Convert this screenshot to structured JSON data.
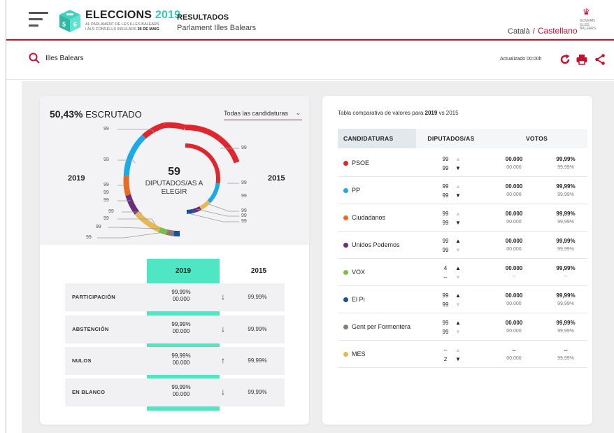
{
  "header": {
    "logo_title": "ELECCIONS",
    "logo_year": "2019",
    "logo_sub1": "AL PARLAMENT DE LES ILLES BALEARS",
    "logo_sub2": "I ALS CONSELLS INSULARS",
    "logo_date": "26 DE MAIG",
    "page_title": "RESULTADOS",
    "page_subtitle": "Parlament Illes Balears",
    "lang_ca": "Català",
    "lang_sep": "/",
    "lang_es": "Castellano",
    "govern_text": [
      "GOVERN",
      "ILLES",
      "BALEARS"
    ]
  },
  "search": {
    "value": "Illes Balears",
    "updated": "Actualizado 00:00h"
  },
  "colors": {
    "accent": "#c8102e",
    "teal": "#4ee6c3",
    "PSOE": "#e0262d",
    "PP": "#1ca9e6",
    "Ciudadanos": "#eb6a22",
    "Unidos Podemos": "#6a2e7c",
    "VOX": "#7ac143",
    "El Pi": "#1a4f9c",
    "Gent per Formentera": "#8c7b75",
    "MES": "#e6b855"
  },
  "summary": {
    "percent": "50,43%",
    "label": "ESCRUTADO",
    "filter": "Todas las candidaturas",
    "year_left": "2019",
    "year_right": "2015",
    "center_number": "59",
    "center_text": "DIPUTADOS/AS A ELEGIR",
    "seat_labels": [
      "99",
      "99",
      "99",
      "99",
      "99",
      "99",
      "99",
      "99",
      "99",
      "99",
      "99",
      "99",
      "99",
      "99",
      "99"
    ]
  },
  "comparison": {
    "col_2019": "2019",
    "col_2015": "2015",
    "rows": [
      {
        "label": "PARTICIPACIÓN",
        "pct": "99,99%",
        "num": "00.000",
        "arrow": "↓",
        "prev": "99,99%"
      },
      {
        "label": "ABSTENCIÓN",
        "pct": "99,99%",
        "num": "00.000",
        "arrow": "↓",
        "prev": "99,99%"
      },
      {
        "label": "NULOS",
        "pct": "99,99%",
        "num": "00.000",
        "arrow": "↑",
        "prev": "99,99%"
      },
      {
        "label": "EN BLANCO",
        "pct": "99,99%",
        "num": "00.000",
        "arrow": "↓",
        "prev": "99,99%"
      }
    ]
  },
  "table": {
    "title_pre": "Tabla comparativa de valores para",
    "title_year": "2019",
    "title_post": "vs 2015",
    "headers": {
      "candidaturas": "CANDIDATURAS",
      "diputados": "DIPUTADOS/AS",
      "votos": "VOTOS"
    },
    "rows": [
      {
        "name": "PSOE",
        "d1": "99",
        "d2": "99",
        "trend": "down",
        "v1": "00.000",
        "v1b": "00.000",
        "v2": "99,99%",
        "v2b": "99,99%"
      },
      {
        "name": "PP",
        "d1": "99",
        "d2": "99",
        "trend": "down",
        "v1": "00.000",
        "v1b": "00.000",
        "v2": "99,99%",
        "v2b": "99,99%"
      },
      {
        "name": "Ciudadanos",
        "d1": "99",
        "d2": "99",
        "trend": "down",
        "v1": "00.000",
        "v1b": "00.000",
        "v2": "99,99%",
        "v2b": "99,99%"
      },
      {
        "name": "Unidos Podemos",
        "d1": "99",
        "d2": "99",
        "trend": "up",
        "v1": "00.000",
        "v1b": "00.000",
        "v2": "99,99%",
        "v2b": "99,99%"
      },
      {
        "name": "VOX",
        "d1": "4",
        "d2": "--",
        "trend": "up",
        "v1": "00.000",
        "v1b": "--",
        "v2": "99,99%",
        "v2b": "--"
      },
      {
        "name": "El Pi",
        "d1": "99",
        "d2": "99",
        "trend": "up",
        "v1": "00.000",
        "v1b": "00.000",
        "v2": "99,99%",
        "v2b": "99,99%"
      },
      {
        "name": "Gent per Formentera",
        "d1": "99",
        "d2": "99",
        "trend": "up",
        "v1": "00.000",
        "v1b": "00.000",
        "v2": "99,99%",
        "v2b": "99,99%"
      },
      {
        "name": "MES",
        "d1": "--",
        "d2": "2",
        "trend": "down",
        "v1": "--",
        "v1b": "00.000",
        "v2": "--",
        "v2b": "99,99%"
      }
    ]
  }
}
